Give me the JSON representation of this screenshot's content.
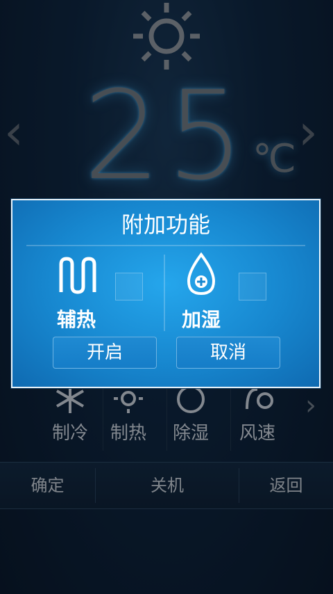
{
  "display": {
    "temperature": "25",
    "unit": "℃",
    "prev_icon": "chevron-left-icon",
    "next_icon": "chevron-right-icon"
  },
  "modes": [
    {
      "label": "制冷",
      "icon": "snowflake-icon"
    },
    {
      "label": "制热",
      "icon": "sun-icon"
    },
    {
      "label": "除湿",
      "icon": "drop-icon"
    },
    {
      "label": "风速",
      "icon": "fan-icon"
    }
  ],
  "bottom_bar": {
    "confirm": "确定",
    "power_off": "关机",
    "back": "返回"
  },
  "dialog": {
    "title": "附加功能",
    "options": [
      {
        "label": "辅热",
        "icon": "heater-icon",
        "checked": false
      },
      {
        "label": "加湿",
        "icon": "humidify-drop-icon",
        "checked": false
      }
    ],
    "buttons": {
      "open": "开启",
      "cancel": "取消"
    }
  },
  "colors": {
    "background": "#0f2742",
    "dialog_blue": "#1787cf",
    "temp_glow": "#50beff"
  }
}
